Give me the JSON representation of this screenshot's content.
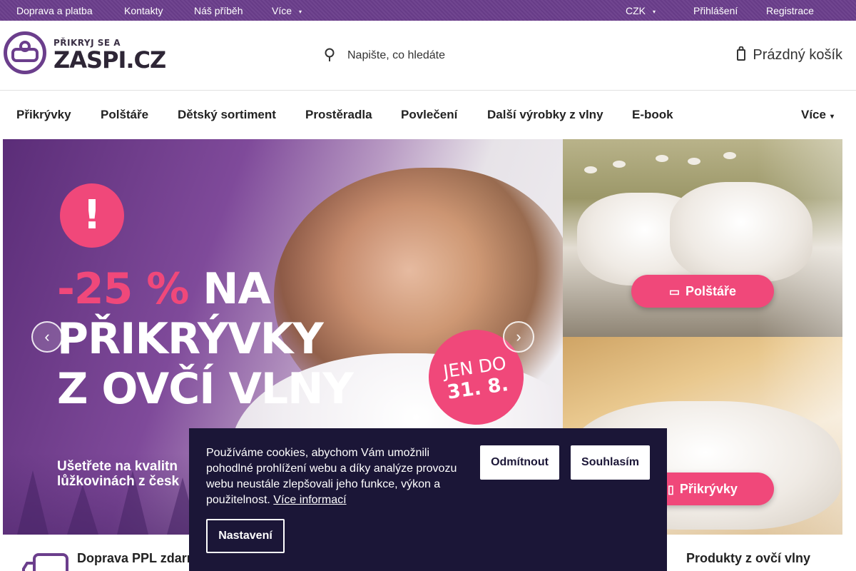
{
  "topbar": {
    "shipping": "Doprava a platba",
    "contacts": "Kontakty",
    "story": "Náš příběh",
    "more": "Více",
    "currency": "CZK",
    "login": "Přihlášení",
    "register": "Registrace"
  },
  "header": {
    "logo_tagline": "PŘIKRYJ SE A",
    "logo_brand": "ZASPI.CZ",
    "search_placeholder": "Napište, co hledáte",
    "cart_label": "Prázdný košík"
  },
  "nav": {
    "items": [
      "Přikrývky",
      "Polštáře",
      "Dětský sortiment",
      "Prostěradla",
      "Povlečení",
      "Další výrobky z vlny",
      "E-book"
    ],
    "more": "Více"
  },
  "hero": {
    "exclamation": "!",
    "discount": "-25 %",
    "line1_rest": "NA",
    "line2": "PŘIKRÝVKY",
    "line3": "Z OVČÍ VLNY",
    "badge_line1": "JEN DO",
    "badge_line2": "31. 8.",
    "subtitle_line1": "Ušetřete na kvalitn",
    "subtitle_line2": "lůžkovinách z česk"
  },
  "side_banners": {
    "pillows_label": "Polštáře",
    "duvets_label": "Přikrývky"
  },
  "benefits": {
    "shipping": "Doprava PPL zdarm",
    "wool": "Produkty z ovčí vlny"
  },
  "cookie": {
    "message": "Používáme cookies, abychom Vám umožnili pohodlné prohlížení webu a díky analýze provozu webu neustále zlepšovali jeho funkce, výkon a použitelnost.",
    "more_info": "Více informací",
    "reject": "Odmítnout",
    "accept": "Souhlasím",
    "settings": "Nastavení"
  },
  "colors": {
    "topbar": "#6b3e8c",
    "accent_pink": "#f0487a",
    "cookie_bg": "#1b1637"
  },
  "icons": {
    "search": "search-icon",
    "cart": "cart-icon",
    "prev": "chevron-left-icon",
    "next": "chevron-right-icon"
  }
}
